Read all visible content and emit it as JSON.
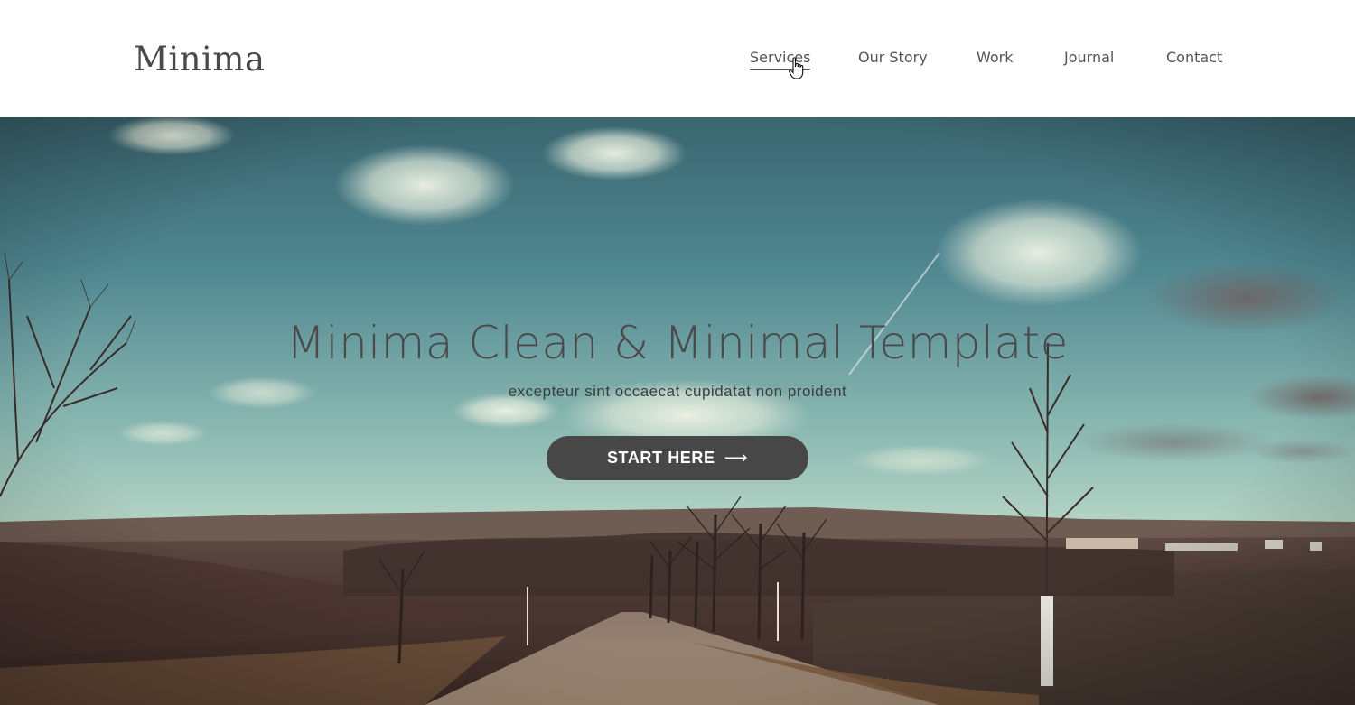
{
  "header": {
    "logo": "Minima",
    "nav": [
      {
        "label": "Services",
        "active": true
      },
      {
        "label": "Our Story",
        "active": false
      },
      {
        "label": "Work",
        "active": false
      },
      {
        "label": "Journal",
        "active": false
      },
      {
        "label": "Contact",
        "active": false
      }
    ]
  },
  "hero": {
    "title": "Minima Clean & Minimal Template",
    "subtitle": "excepteur sint occaecat cupidatat non proident",
    "cta_label": "START HERE",
    "cta_icon": "arrow-right-icon"
  },
  "colors": {
    "text_dark": "#4a4a4a",
    "button_bg": "#474747",
    "sky_top": "#3f6b74",
    "sky_horizon": "#b9d6c6",
    "field": "#5a4038"
  }
}
